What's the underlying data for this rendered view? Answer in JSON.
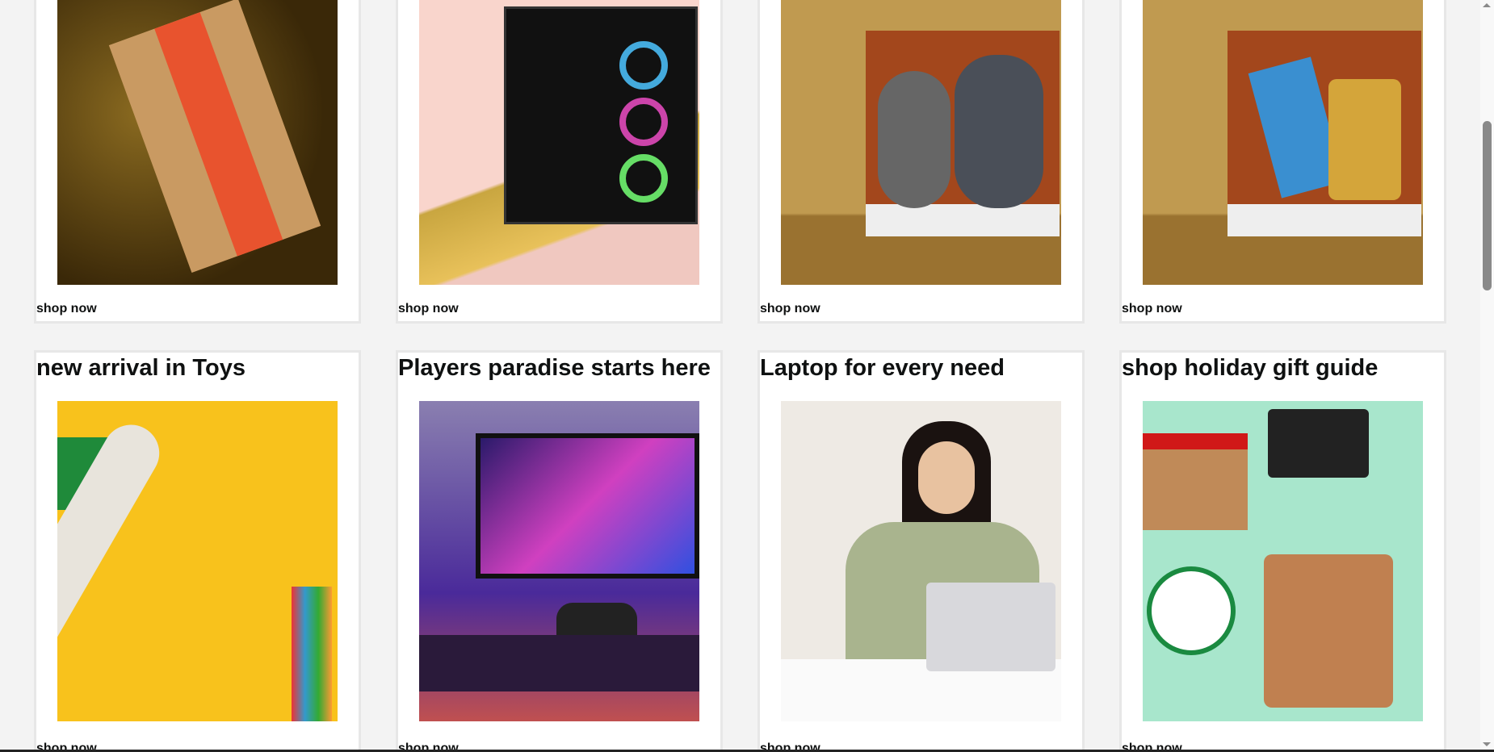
{
  "top_row": [
    {
      "link": "shop now",
      "image": "amazon-box-on-gold-tinsel"
    },
    {
      "link": "shop now",
      "image": "gaming-pc-case-rgb"
    },
    {
      "link": "shop now",
      "image": "plush-toys-in-gift-box"
    },
    {
      "link": "shop now",
      "image": "tie-and-boot-in-gift-box"
    }
  ],
  "bottom_row": [
    {
      "title": "new arrival in Toys",
      "link": "shop now",
      "image": "toy-airplane-on-yellow"
    },
    {
      "title": "Players paradise starts here",
      "link": "shop now",
      "image": "gaming-controller-and-monitor"
    },
    {
      "title": "Laptop for every need",
      "link": "shop now",
      "image": "woman-with-laptop"
    },
    {
      "title": "shop holiday gift guide",
      "link": "shop now",
      "image": "holiday-gift-flatlay"
    }
  ]
}
